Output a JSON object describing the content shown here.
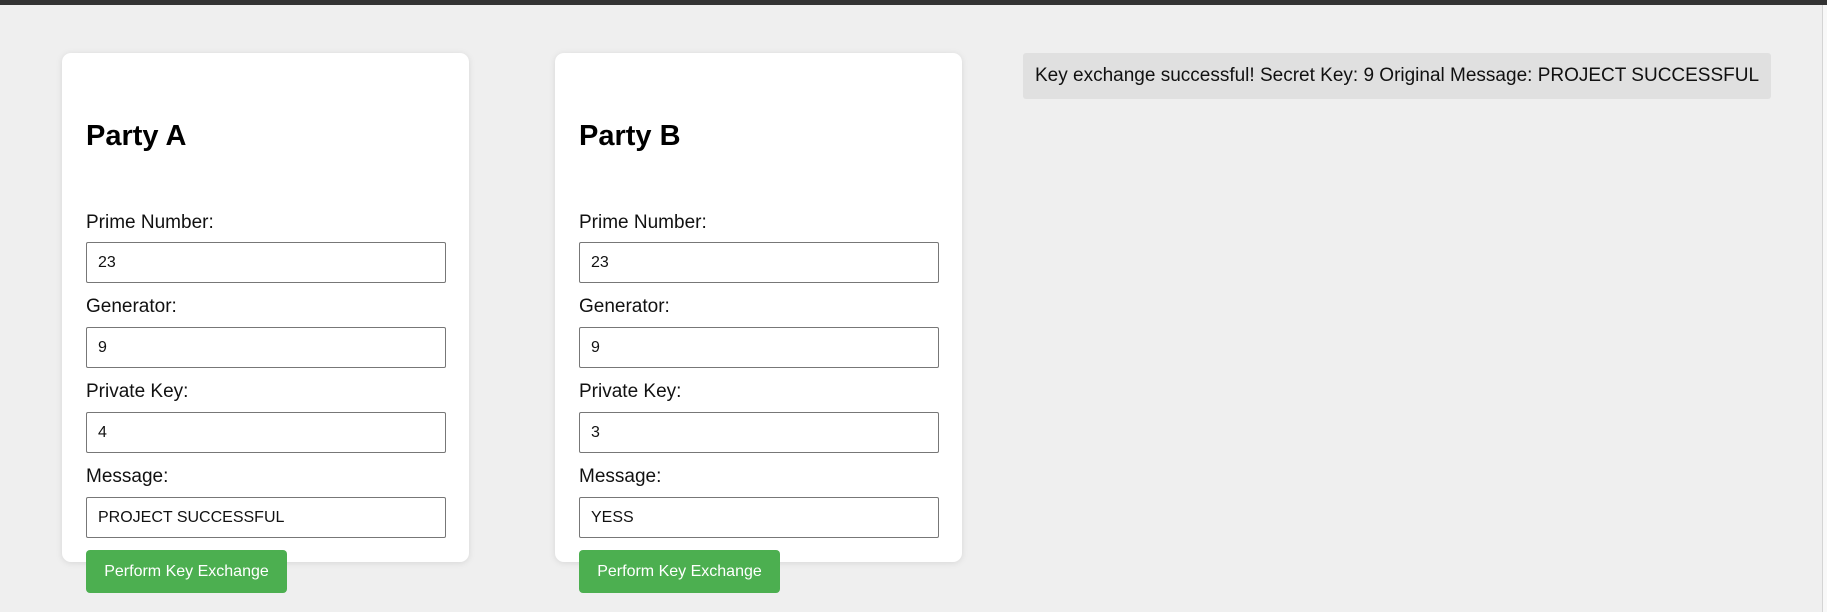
{
  "party_a": {
    "title": "Party A",
    "prime_label": "Prime Number:",
    "prime_value": "23",
    "generator_label": "Generator:",
    "generator_value": "9",
    "private_key_label": "Private Key:",
    "private_key_value": "4",
    "message_label": "Message:",
    "message_value": "PROJECT SUCCESSFUL",
    "button_label": "Perform Key Exchange"
  },
  "party_b": {
    "title": "Party B",
    "prime_label": "Prime Number:",
    "prime_value": "23",
    "generator_label": "Generator:",
    "generator_value": "9",
    "private_key_label": "Private Key:",
    "private_key_value": "3",
    "message_label": "Message:",
    "message_value": "YESS",
    "button_label": "Perform Key Exchange"
  },
  "result": {
    "text": "Key exchange successful! Secret Key: 9 Original Message: PROJECT SUCCESSFUL"
  },
  "colors": {
    "page_background": "#efefef",
    "card_background": "#ffffff",
    "button_background": "#4caf50",
    "button_text": "#ffffff",
    "result_background": "#e0e0e0",
    "top_bar": "#333333"
  }
}
